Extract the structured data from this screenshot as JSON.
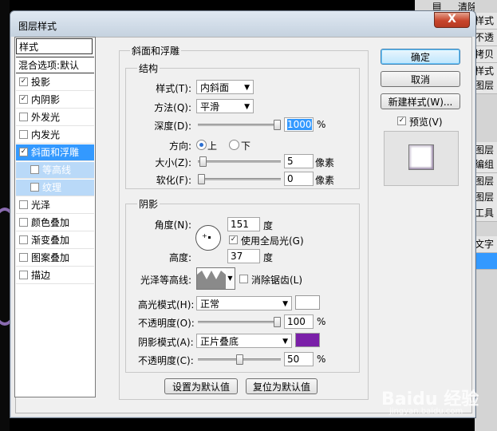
{
  "background": {
    "top_strip": "清除图层",
    "items": [
      "样式",
      "不透",
      "拷贝",
      "样式",
      "图层",
      "图层",
      "编组",
      "图层",
      "图层",
      "工具",
      "文字",
      ""
    ]
  },
  "dialog": {
    "title": "图层样式",
    "close_label": "X",
    "styles_header": "样式",
    "blending_label": "混合选项:默认",
    "style_items": [
      {
        "label": "投影",
        "checked": true
      },
      {
        "label": "内阴影",
        "checked": true
      },
      {
        "label": "外发光",
        "checked": false
      },
      {
        "label": "内发光",
        "checked": false
      },
      {
        "label": "斜面和浮雕",
        "checked": true
      },
      {
        "label": "等高线",
        "checked": false
      },
      {
        "label": "纹理",
        "checked": false
      },
      {
        "label": "光泽",
        "checked": false
      },
      {
        "label": "颜色叠加",
        "checked": false
      },
      {
        "label": "渐变叠加",
        "checked": false
      },
      {
        "label": "图案叠加",
        "checked": false
      },
      {
        "label": "描边",
        "checked": false
      }
    ],
    "bevel": {
      "group_title": "斜面和浮雕",
      "structure_title": "结构",
      "style_label": "样式(T):",
      "style_value": "内斜面",
      "technique_label": "方法(Q):",
      "technique_value": "平滑",
      "depth_label": "深度(D):",
      "depth_value": "1000",
      "depth_unit": "%",
      "depth_fraction": 1.0,
      "direction_label": "方向:",
      "direction_up": "上",
      "direction_down": "下",
      "size_label": "大小(Z):",
      "size_value": "5",
      "size_unit": "像素",
      "size_fraction": 0.02,
      "soften_label": "软化(F):",
      "soften_value": "0",
      "soften_unit": "像素",
      "soften_fraction": 0.0
    },
    "shading": {
      "title": "阴影",
      "angle_label": "角度(N):",
      "angle_value": "151",
      "angle_unit": "度",
      "global_light_label": "使用全局光(G)",
      "altitude_label": "高度:",
      "altitude_value": "37",
      "altitude_unit": "度",
      "gloss_contour_label": "光泽等高线:",
      "anti_alias_label": "消除锯齿(L)",
      "highlight_mode_label": "高光模式(H):",
      "highlight_mode_value": "正常",
      "highlight_color": "#ffffff",
      "highlight_opacity_label": "不透明度(O):",
      "highlight_opacity_value": "100",
      "highlight_opacity_fraction": 1.0,
      "shadow_mode_label": "阴影模式(A):",
      "shadow_mode_value": "正片叠底",
      "shadow_color": "#7a1fa8",
      "shadow_opacity_label": "不透明度(C):",
      "shadow_opacity_value": "50",
      "shadow_opacity_fraction": 0.5,
      "percent": "%"
    },
    "set_default": "设置为默认值",
    "reset_default": "复位为默认值",
    "ok": "确定",
    "cancel": "取消",
    "new_style": "新建样式(W)...",
    "preview_label": "预览(V)"
  },
  "watermark": {
    "text": "Baidu 经验",
    "sub": "jingyan.baidu.com"
  }
}
